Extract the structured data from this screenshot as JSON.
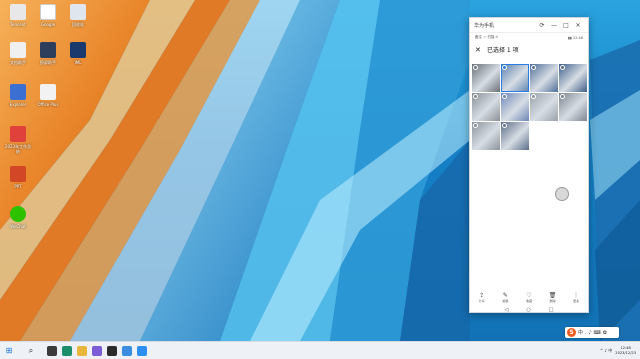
{
  "desktop": {
    "icons": [
      {
        "label": "Tencent",
        "icon": "app-icon"
      },
      {
        "label": "Google",
        "icon": "chrome-icon"
      },
      {
        "label": "回收站",
        "icon": "recycle-bin-icon"
      },
      {
        "label": "文档助手",
        "icon": "app-icon"
      },
      {
        "label": "投屏助手",
        "icon": "monitor-icon"
      },
      {
        "label": "IML",
        "icon": "iml-icon"
      },
      {
        "label": "Explorer",
        "icon": "file-icon"
      },
      {
        "label": "Office Plus",
        "icon": "office-icon"
      },
      {
        "label": "2023年工作总结",
        "icon": "ppt-file-icon"
      },
      {
        "label": "WeChat",
        "icon": "wechat-icon"
      }
    ]
  },
  "phone_window": {
    "app_title": "华为手机",
    "title_controls": [
      "⟳",
      "—",
      "□",
      "✕"
    ],
    "status_left": "备注 ☆ 扫描 ⊙",
    "status_right": "▮▮ 12:48",
    "selection_title": "已选择 1 项",
    "close_label": "✕",
    "thumbnails": [
      {
        "selected": false,
        "tone": "#6a6f78"
      },
      {
        "selected": true,
        "tone": "#5a7fb0"
      },
      {
        "selected": false,
        "tone": "#4f6f9a"
      },
      {
        "selected": false,
        "tone": "#3f5f8a"
      },
      {
        "selected": false,
        "tone": "#8a8f96"
      },
      {
        "selected": false,
        "tone": "#6e87b8"
      },
      {
        "selected": false,
        "tone": "#9aa2aa"
      },
      {
        "selected": false,
        "tone": "#7d8590"
      },
      {
        "selected": false,
        "tone": "#8b939c"
      },
      {
        "selected": false,
        "tone": "#5b6d8a"
      }
    ],
    "actions": [
      {
        "icon": "share-icon",
        "glyph": "⇪",
        "label": "分享"
      },
      {
        "icon": "edit-icon",
        "glyph": "✎",
        "label": "编辑"
      },
      {
        "icon": "favorite-icon",
        "glyph": "♡",
        "label": "收藏"
      },
      {
        "icon": "delete-icon",
        "glyph": "🗑",
        "label": "删除"
      },
      {
        "icon": "more-icon",
        "glyph": "⋮",
        "label": "更多"
      }
    ],
    "nav": [
      "◁",
      "○",
      "□"
    ]
  },
  "taskbar": {
    "start_glyph": "⊞",
    "search_glyph": "⌕",
    "apps": [
      {
        "name": "taskview-icon",
        "color": "#3a3a3a"
      },
      {
        "name": "edge-icon",
        "color": "#1e8e6a"
      },
      {
        "name": "explorer-icon",
        "color": "#e8b63b"
      },
      {
        "name": "store-icon",
        "color": "#7a5cd6"
      },
      {
        "name": "terminal-icon",
        "color": "#2b2b2b"
      },
      {
        "name": "mail-icon",
        "color": "#3a8de0"
      },
      {
        "name": "phone-link-icon",
        "color": "#2d8ff0"
      }
    ],
    "tray_text": "^ ♪ 中",
    "time": "12:48",
    "date": "2023/12/23"
  },
  "ime": {
    "logo": "S",
    "items": [
      "中",
      "⸳",
      "♪",
      "⌨",
      "✿"
    ]
  }
}
